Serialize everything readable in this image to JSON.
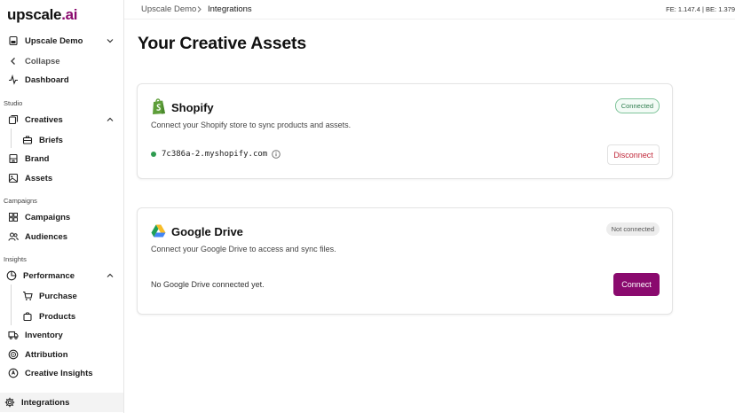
{
  "brand": {
    "name_main": "upscale",
    "name_suffix": ".ai",
    "accent": "#8a0a6e"
  },
  "sidebar": {
    "workspace": "Upscale Demo",
    "collapse": "Collapse",
    "dashboard": "Dashboard",
    "sections": {
      "studio": "Studio",
      "campaigns": "Campaigns",
      "insights": "Insights"
    },
    "creatives": "Creatives",
    "briefs": "Briefs",
    "brand": "Brand",
    "assets": "Assets",
    "campaigns": "Campaigns",
    "audiences": "Audiences",
    "performance": "Performance",
    "purchase": "Purchase",
    "products": "Products",
    "inventory": "Inventory",
    "attribution": "Attribution",
    "creative_insights": "Creative Insights",
    "integrations": "Integrations"
  },
  "header": {
    "breadcrumb": [
      "Upscale Demo",
      "Integrations"
    ],
    "version": "FE: 1.147.4 | BE: 1.379"
  },
  "main": {
    "title": "Your Creative Assets",
    "shopify": {
      "name": "Shopify",
      "description": "Connect your Shopify store to sync products and assets.",
      "status": "Connected",
      "store": "7c386a-2.myshopify.com",
      "action": "Disconnect",
      "status_color": "#2e9b4f"
    },
    "google_drive": {
      "name": "Google Drive",
      "description": "Connect your Google Drive to access and sync files.",
      "status": "Not connected",
      "empty": "No Google Drive connected yet.",
      "action": "Connect"
    }
  }
}
